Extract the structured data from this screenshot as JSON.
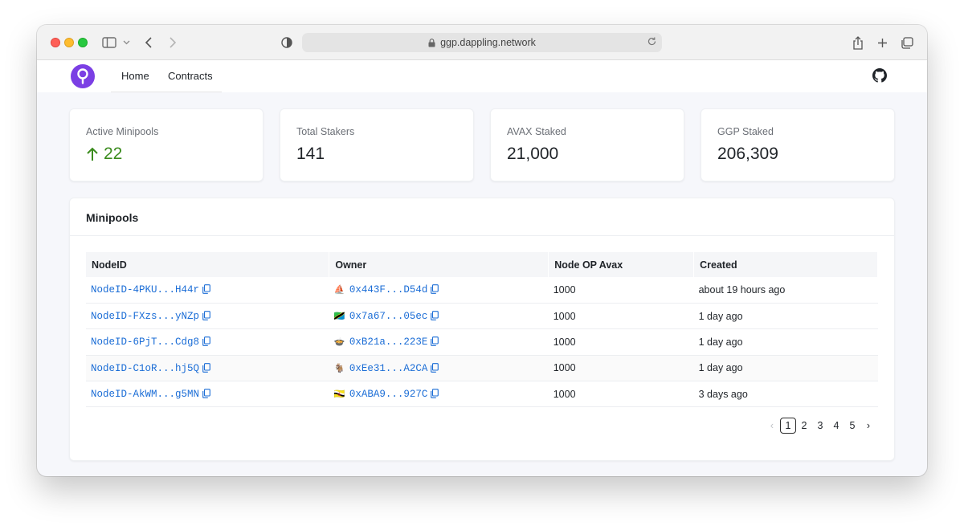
{
  "browser": {
    "url": "ggp.dappling.network"
  },
  "nav": {
    "links": [
      "Home",
      "Contracts"
    ]
  },
  "stats": [
    {
      "label": "Active Minipools",
      "value": "22",
      "trend": "up"
    },
    {
      "label": "Total Stakers",
      "value": "141"
    },
    {
      "label": "AVAX Staked",
      "value": "21,000"
    },
    {
      "label": "GGP Staked",
      "value": "206,309"
    }
  ],
  "minipools": {
    "title": "Minipools",
    "columns": [
      "NodeID",
      "Owner",
      "Node OP Avax",
      "Created"
    ],
    "rows": [
      {
        "node_id": "NodeID-4PKU...H44r",
        "owner_icon": "⛵",
        "owner": "0x443F...D54d",
        "avax": "1000",
        "created": "about 19 hours ago"
      },
      {
        "node_id": "NodeID-FXzs...yNZp",
        "owner_icon": "🇹🇿",
        "owner": "0x7a67...05ec",
        "avax": "1000",
        "created": "1 day ago"
      },
      {
        "node_id": "NodeID-6PjT...Cdg8",
        "owner_icon": "🍲",
        "owner": "0xB21a...223E",
        "avax": "1000",
        "created": "1 day ago"
      },
      {
        "node_id": "NodeID-C1oR...hj5Q",
        "owner_icon": "🐐",
        "owner": "0xEe31...A2CA",
        "avax": "1000",
        "created": "1 day ago"
      },
      {
        "node_id": "NodeID-AkWM...g5MN",
        "owner_icon": "🇧🇳",
        "owner": "0xABA9...927C",
        "avax": "1000",
        "created": "3 days ago"
      }
    ]
  },
  "pagination": {
    "pages": [
      "1",
      "2",
      "3",
      "4",
      "5"
    ],
    "current": "1",
    "prev": "‹",
    "next": "›"
  },
  "colors": {
    "accent": "#7b3fe4",
    "link": "#1b6dd6",
    "trend_up": "#3a8b1d"
  }
}
